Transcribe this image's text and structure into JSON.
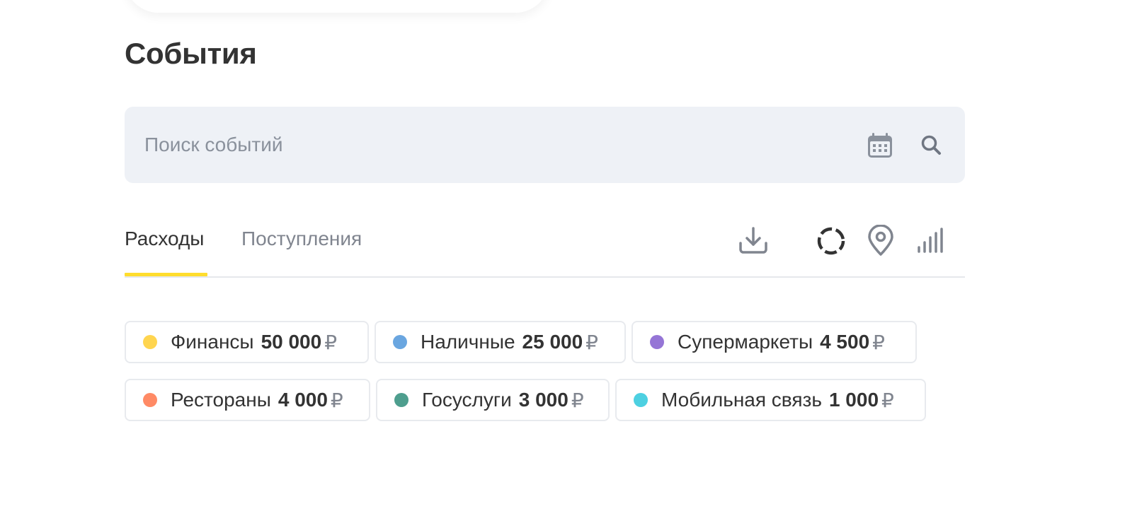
{
  "page": {
    "title": "События"
  },
  "search": {
    "placeholder": "Поиск событий",
    "calendar_icon": "calendar-icon",
    "search_icon": "search-icon"
  },
  "tabs": [
    {
      "label": "Расходы",
      "active": true
    },
    {
      "label": "Поступления",
      "active": false
    }
  ],
  "toolbar": {
    "icons": [
      "download-icon",
      "donut-chart-icon",
      "location-pin-icon",
      "bar-chart-icon"
    ]
  },
  "categories": [
    {
      "label": "Финансы",
      "amount": "50 000",
      "currency": "₽",
      "color": "#ffd54f"
    },
    {
      "label": "Наличные",
      "amount": "25 000",
      "currency": "₽",
      "color": "#6aa6e0"
    },
    {
      "label": "Супермаркеты",
      "amount": "4 500",
      "currency": "₽",
      "color": "#9575d6"
    },
    {
      "label": "Рестораны",
      "amount": "4 000",
      "currency": "₽",
      "color": "#ff8a65"
    },
    {
      "label": "Госуслуги",
      "amount": "3 000",
      "currency": "₽",
      "color": "#4e9e8e"
    },
    {
      "label": "Мобильная связь",
      "amount": "1 000",
      "currency": "₽",
      "color": "#4dd0e1"
    }
  ],
  "colors": {
    "accent": "#ffdd2d",
    "search_background": "#eef1f6",
    "text_primary": "#333333",
    "text_secondary": "#80858f"
  }
}
